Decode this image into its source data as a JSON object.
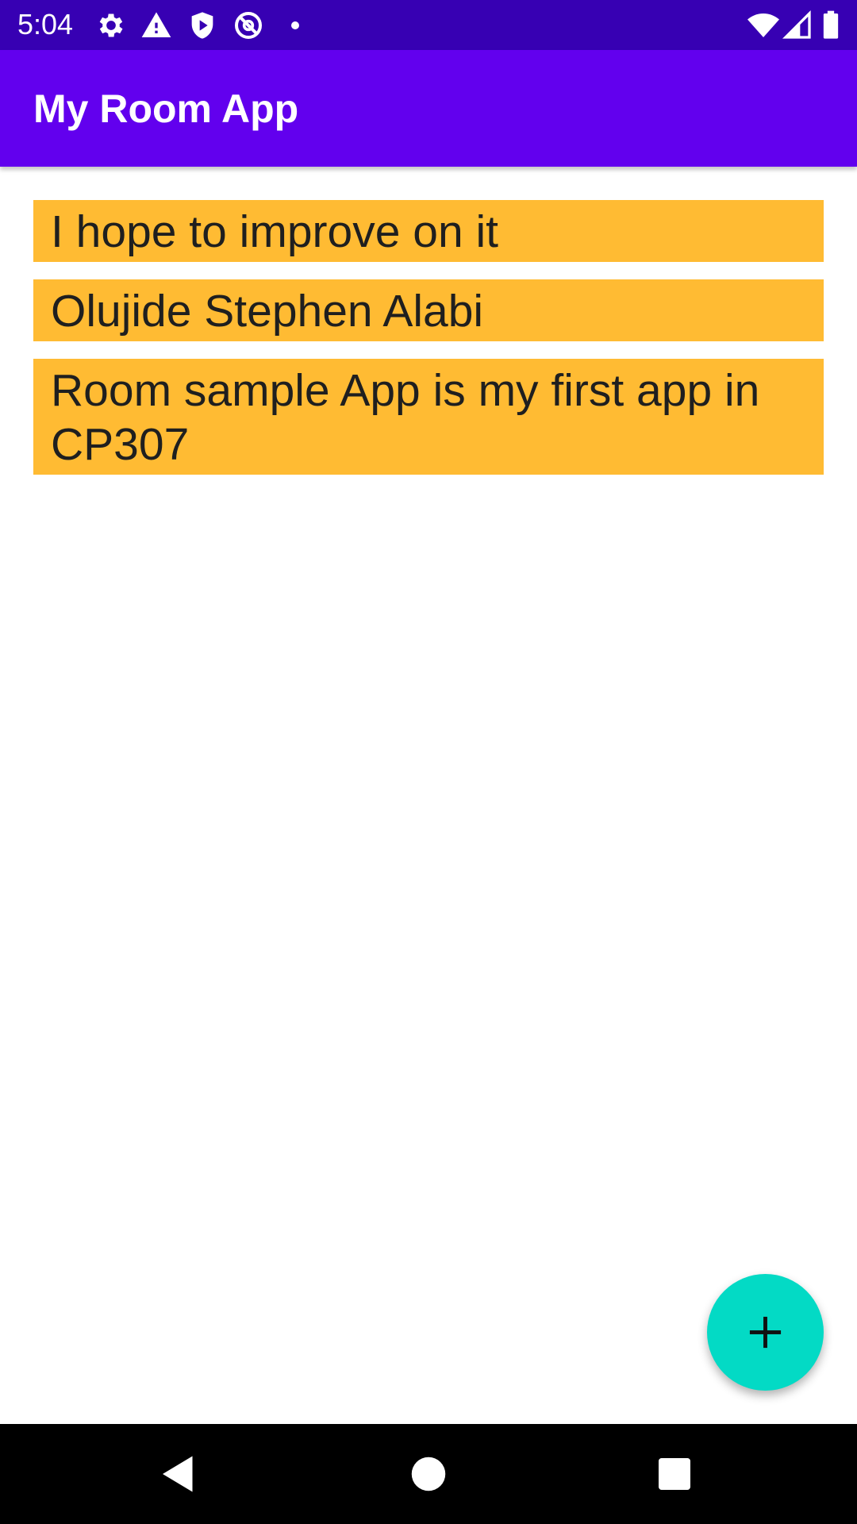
{
  "status_bar": {
    "time": "5:04",
    "background_color": "#3700B3",
    "left_icons": [
      "gear-icon",
      "warning-icon",
      "shield-play-icon",
      "at-blocked-icon",
      "dot-icon"
    ],
    "right_icons": [
      "wifi-icon",
      "cell-signal-icon",
      "battery-icon"
    ]
  },
  "app_bar": {
    "title": "My Room App",
    "background_color": "#6200EE"
  },
  "notes": [
    {
      "text": "I hope to improve on it"
    },
    {
      "text": "Olujide Stephen Alabi"
    },
    {
      "text": "Room sample App is my first app in CP307"
    }
  ],
  "note_color": "#FFBB33",
  "fab": {
    "icon": "plus-icon",
    "color": "#03DAC5"
  },
  "nav_bar": {
    "buttons": [
      "back-icon",
      "home-icon",
      "recents-icon"
    ]
  }
}
